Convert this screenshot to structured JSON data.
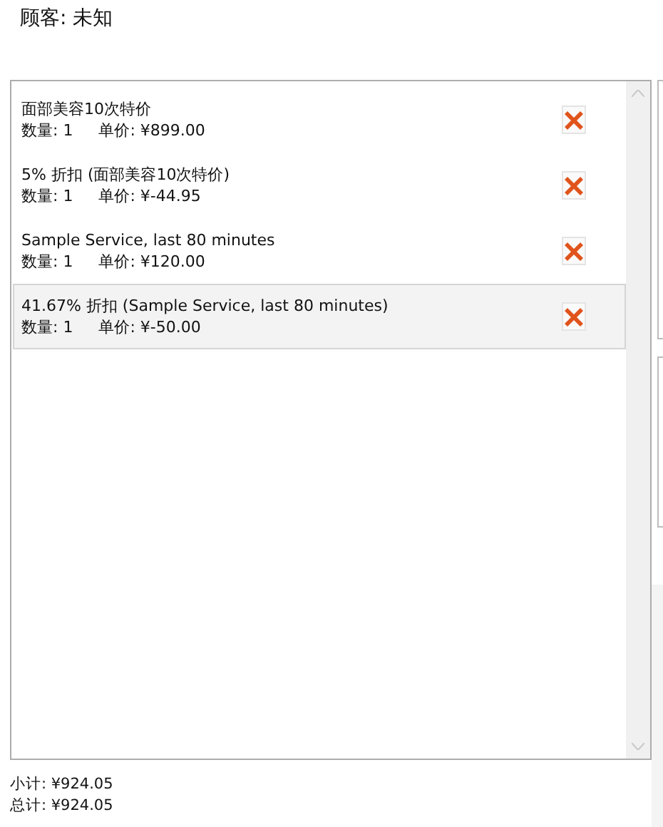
{
  "customer": "顾客: 未知",
  "items": [
    {
      "name": "面部美容10次特价",
      "quantity": "数量: 1",
      "price": "单价: ¥899.00",
      "selected": false
    },
    {
      "name": "5% 折扣 (面部美容10次特价)",
      "quantity": "数量: 1",
      "price": "单价: ¥-44.95",
      "selected": false
    },
    {
      "name": "Sample Service, last 80 minutes",
      "quantity": "数量: 1",
      "price": "单价: ¥120.00",
      "selected": false
    },
    {
      "name": "41.67% 折扣 (Sample Service, last 80 minutes)",
      "quantity": "数量: 1",
      "price": "单价: ¥-50.00",
      "selected": true
    }
  ],
  "subtotal": "小计: ¥924.05",
  "total": "总计: ¥924.05"
}
